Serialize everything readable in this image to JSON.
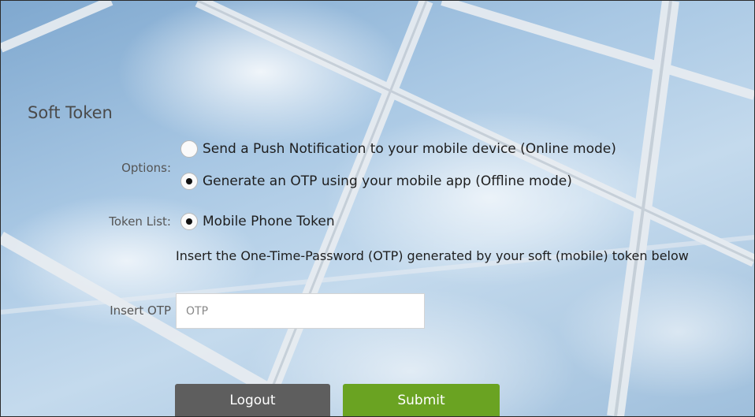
{
  "page": {
    "title": "Soft Token",
    "colors": {
      "submit": "#6aa322",
      "logout": "#5e5e5e"
    }
  },
  "options": {
    "label": "Options:",
    "items": [
      {
        "label": "Send a Push Notification to your mobile device (Online mode)",
        "checked": false
      },
      {
        "label": "Generate an OTP using your mobile app (Offline mode)",
        "checked": true
      }
    ]
  },
  "token_list": {
    "label": "Token List:",
    "items": [
      {
        "label": "Mobile Phone Token",
        "checked": true
      }
    ]
  },
  "otp": {
    "hint": "Insert the One-Time-Password (OTP) generated by your soft (mobile) token below",
    "label": "Insert OTP",
    "placeholder": "OTP",
    "value": ""
  },
  "buttons": {
    "logout": "Logout",
    "submit": "Submit"
  }
}
